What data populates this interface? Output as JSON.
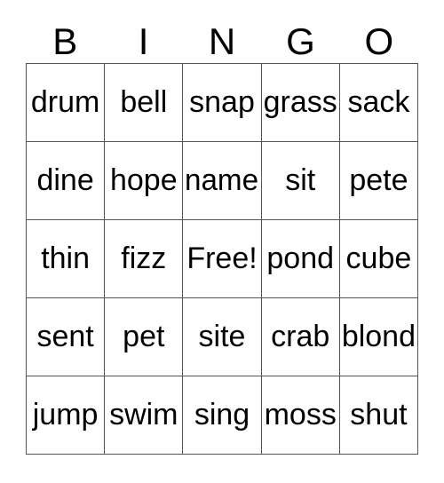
{
  "card": {
    "title_letters": [
      "B",
      "I",
      "N",
      "G",
      "O"
    ],
    "rows": [
      [
        "drum",
        "bell",
        "snap",
        "grass",
        "sack"
      ],
      [
        "dine",
        "hope",
        "name",
        "sit",
        "pete"
      ],
      [
        "thin",
        "fizz",
        "Free!",
        "pond",
        "cube"
      ],
      [
        "sent",
        "pet",
        "site",
        "crab",
        "blond"
      ],
      [
        "jump",
        "swim",
        "sing",
        "moss",
        "shut"
      ]
    ],
    "free_space_label": "Free!",
    "free_space_position": {
      "row": 2,
      "col": 2
    },
    "colors": {
      "text": "#000000",
      "border": "#555555",
      "background": "#ffffff"
    }
  }
}
